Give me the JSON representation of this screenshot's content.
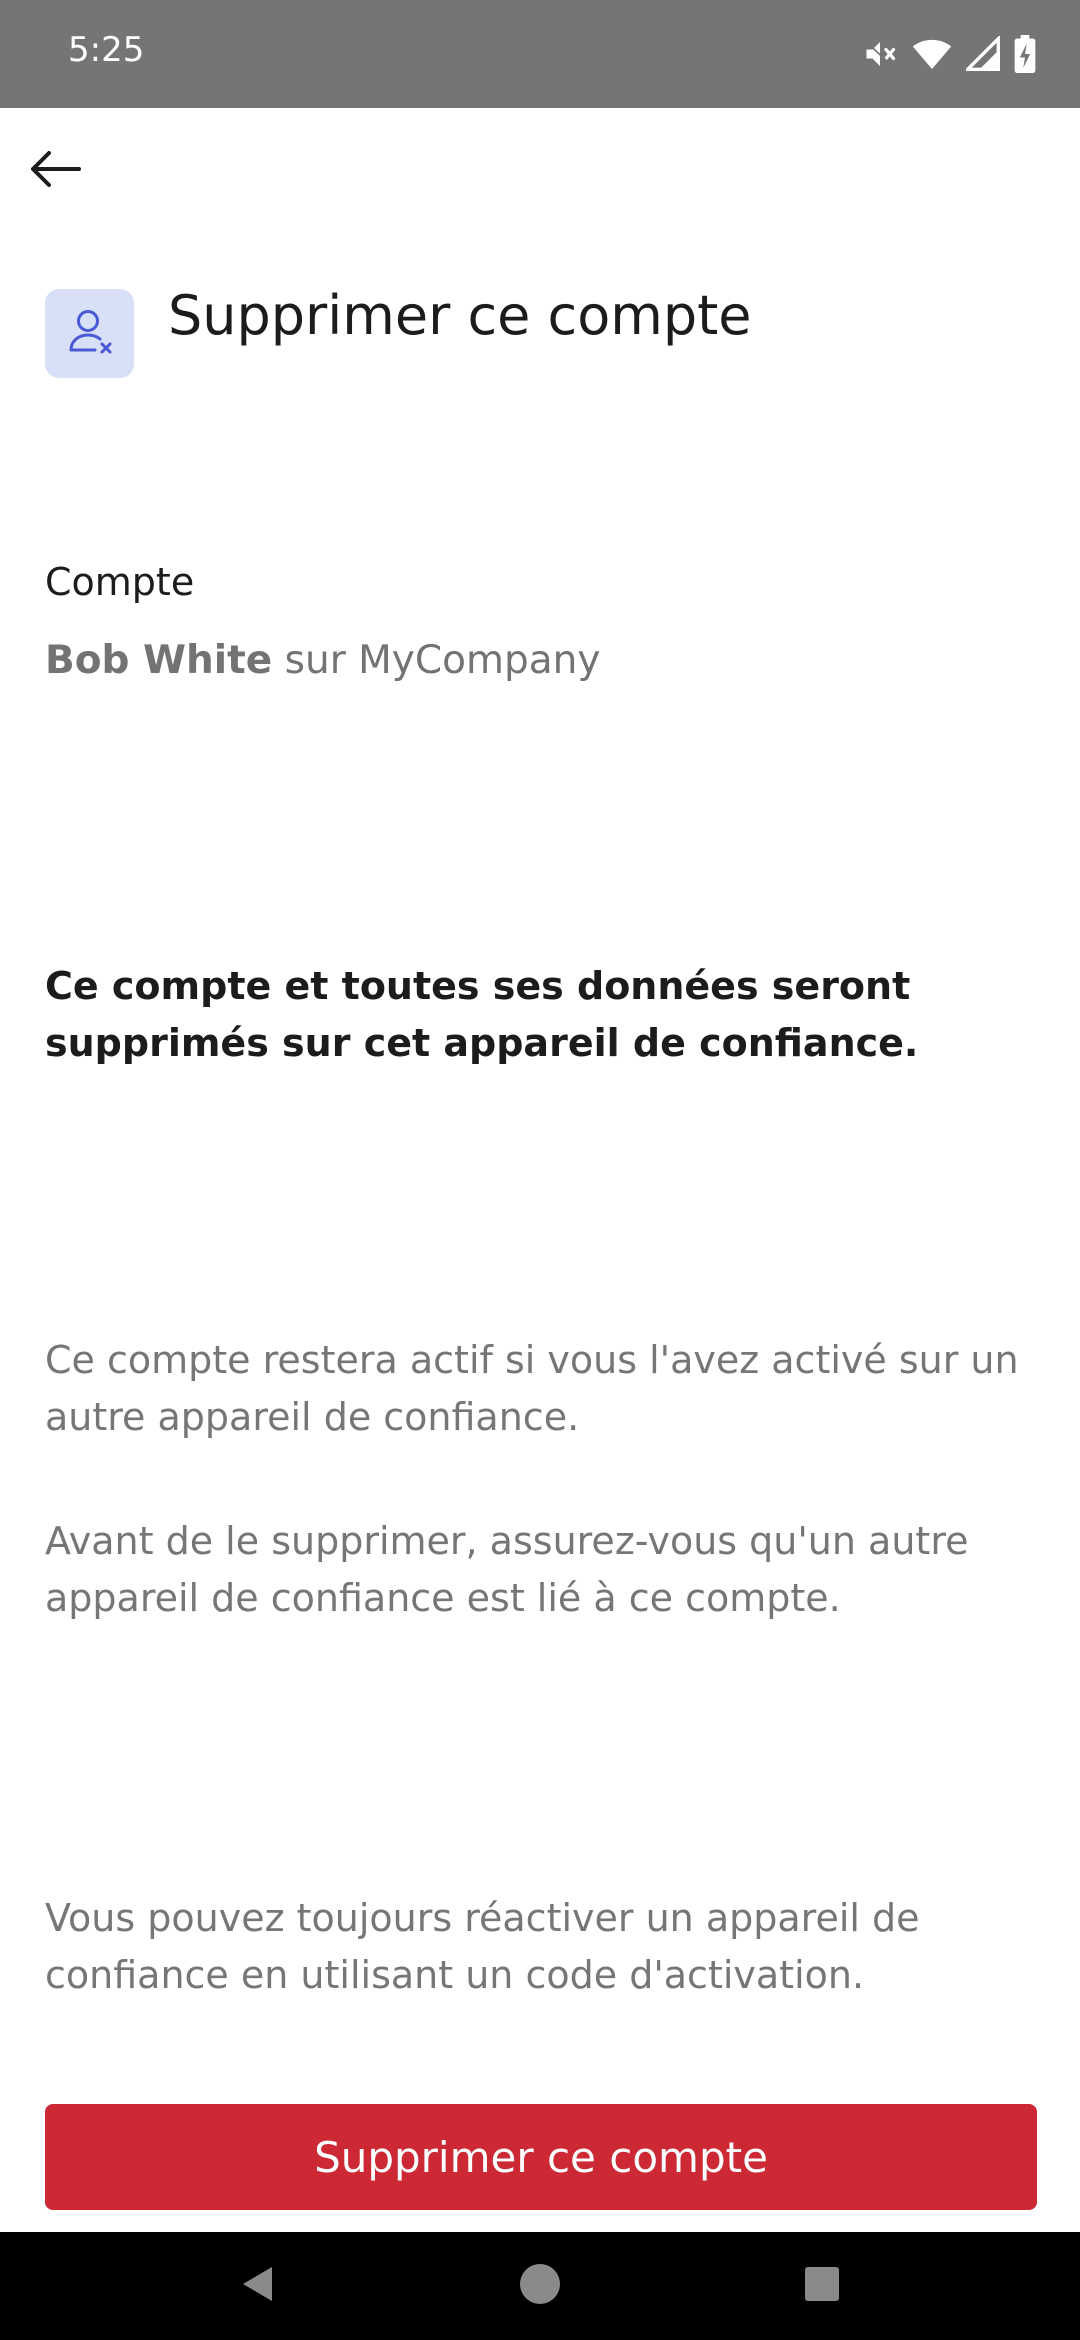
{
  "status_bar": {
    "time": "5:25",
    "icons": [
      "vibrate-off-icon",
      "wifi-icon",
      "signal-icon",
      "battery-charging-icon"
    ]
  },
  "toolbar": {
    "back_icon": "arrow-left-icon"
  },
  "header": {
    "icon": "user-remove-icon",
    "title": "Supprimer ce compte"
  },
  "account": {
    "label": "Compte",
    "user_name": "Bob White",
    "connector": "sur",
    "company": "MyCompany"
  },
  "warning": "Ce compte et toutes ses données seront supprimés sur cet appareil de confiance.",
  "info": [
    "Ce compte restera actif si vous l'avez activé sur un autre appareil de confiance.",
    "Avant de le supprimer, assurez-vous qu'un autre appareil de confiance est lié à ce compte.",
    "Vous pouvez toujours réactiver un appareil de confiance en utilisant un code d'activation."
  ],
  "actions": {
    "delete_label": "Supprimer ce compte"
  },
  "colors": {
    "status_bar": "#757575",
    "danger": "#cc2935",
    "icon_bg": "#d7e0f7",
    "icon_accent": "#4a58d6"
  }
}
